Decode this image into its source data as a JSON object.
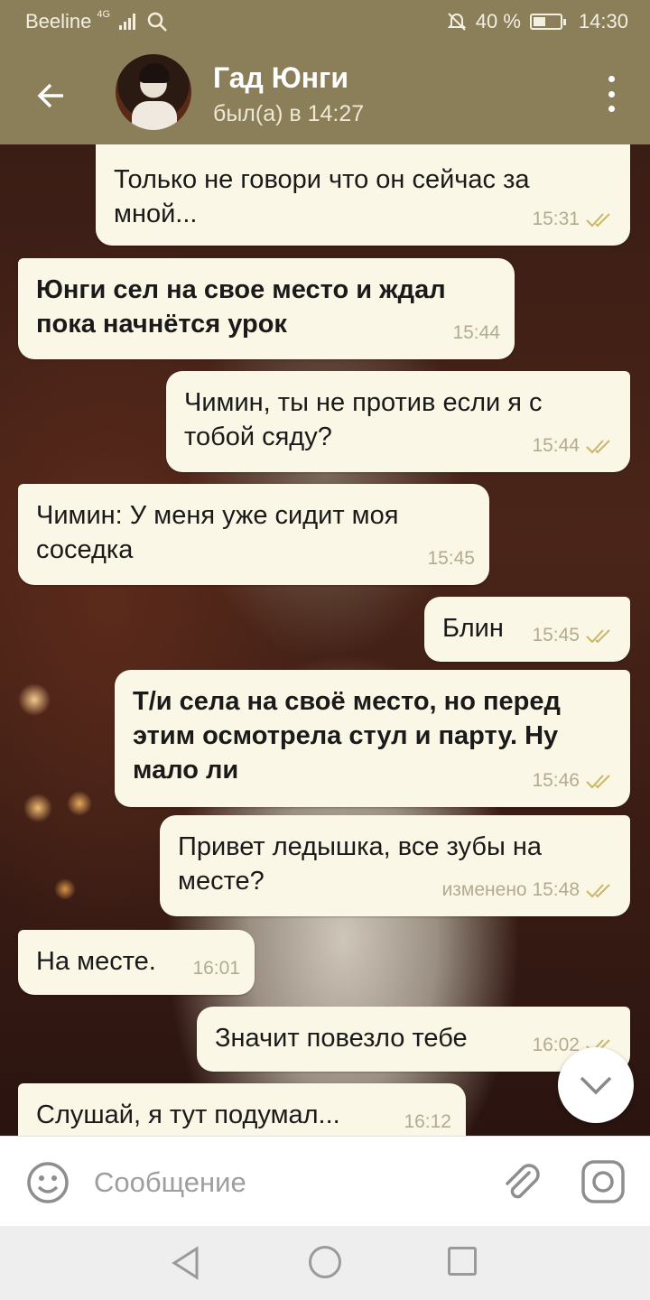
{
  "status_bar": {
    "carrier": "Beeline",
    "network_type": "4G",
    "battery_percent": "40 %",
    "time": "14:30"
  },
  "header": {
    "contact_name": "Гад Юнги",
    "last_seen": "был(а) в 14:27"
  },
  "messages": [
    {
      "side": "out",
      "text": "Только не говори что он сейчас за мной...",
      "time": "15:31",
      "read": true
    },
    {
      "side": "in",
      "text": "Юнги сел на свое место и ждал пока начнётся урок",
      "time": "15:44",
      "bold": true
    },
    {
      "side": "out",
      "text": "Чимин, ты не против если я с тобой сяду?",
      "time": "15:44",
      "read": true
    },
    {
      "side": "in",
      "text": "Чимин: У меня уже сидит моя соседка",
      "time": "15:45"
    },
    {
      "side": "out",
      "text": "Блин",
      "time": "15:45",
      "read": true
    },
    {
      "side": "out",
      "text": "Т/и села на своё место, но перед этим осмотрела стул и парту. Ну мало ли",
      "time": "15:46",
      "read": true,
      "bold": true
    },
    {
      "side": "out",
      "text": "Привет ледышка, все зубы на месте?",
      "time": "изменено 15:48",
      "read": true
    },
    {
      "side": "in",
      "text": "На месте.",
      "time": "16:01"
    },
    {
      "side": "out",
      "text": "Значит повезло тебе",
      "time": "16:02",
      "read": true
    },
    {
      "side": "in",
      "text": "Слушай, я тут подумал...",
      "time": "16:12"
    }
  ],
  "input": {
    "placeholder": "Сообщение"
  },
  "colors": {
    "header_bg": "#8a7f58",
    "bubble_bg": "#fbf7e6",
    "tick_color": "#c9b66a"
  },
  "icons": [
    "back-arrow-icon",
    "more-vert-icon",
    "emoji-icon",
    "attach-icon",
    "camera-icon",
    "chevron-down-icon",
    "nav-back-icon",
    "nav-home-icon",
    "nav-recent-icon"
  ]
}
